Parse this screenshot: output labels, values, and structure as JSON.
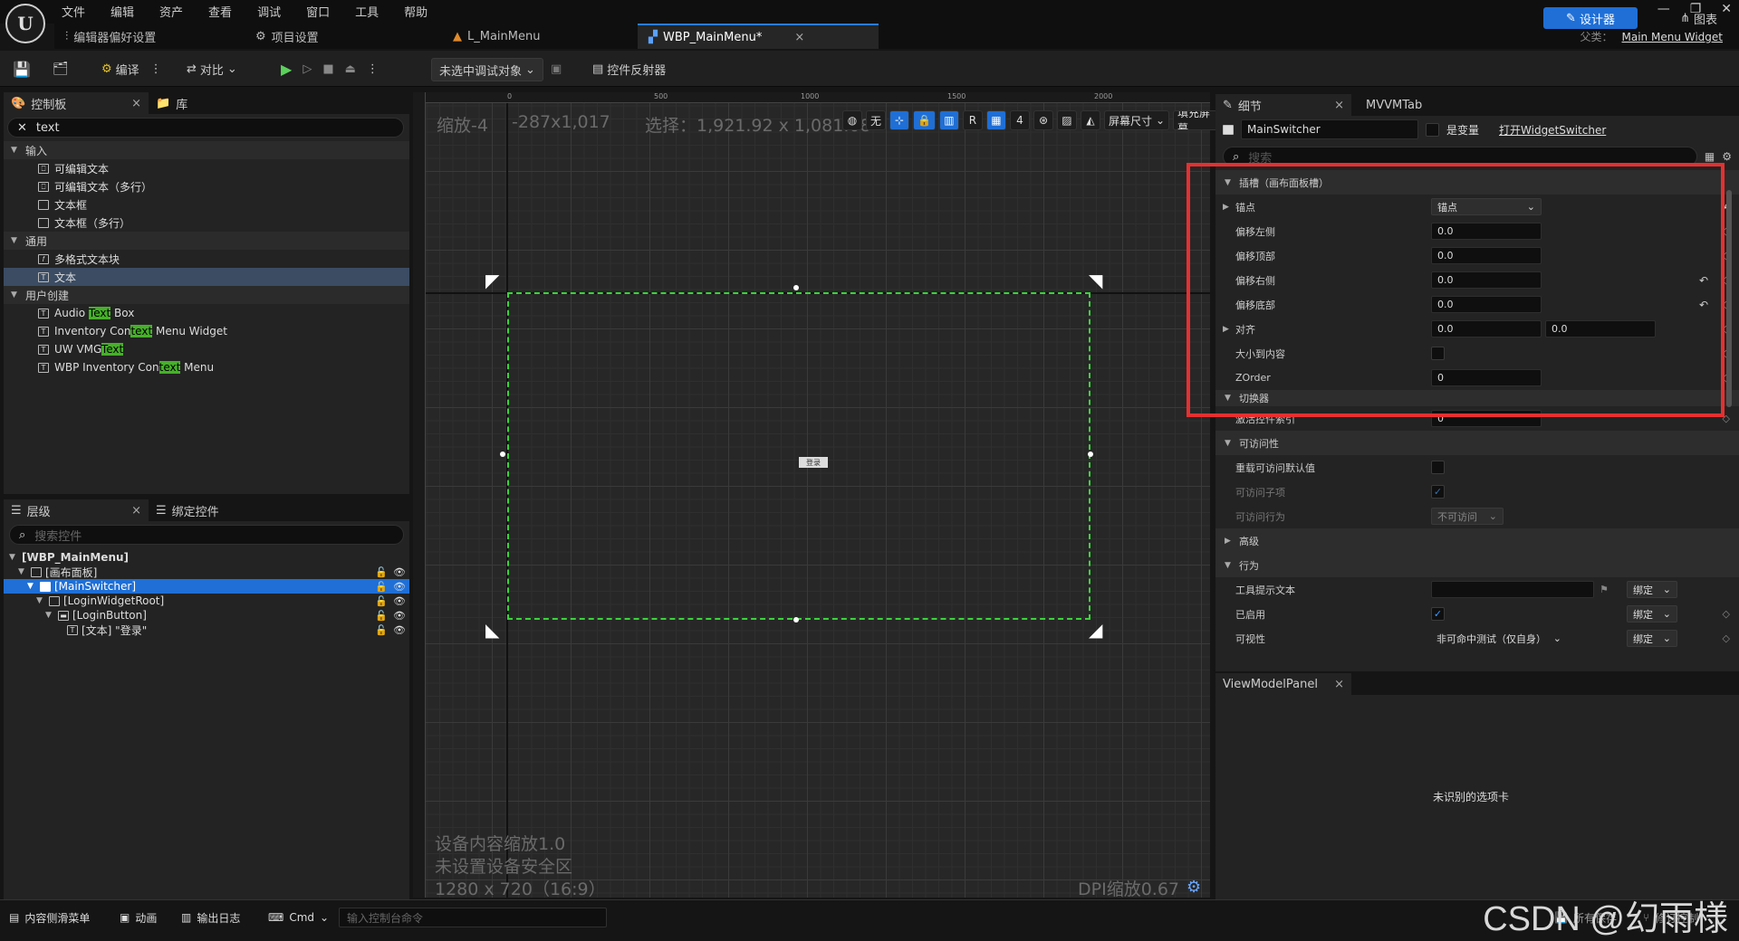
{
  "menu": [
    "文件",
    "编辑",
    "资产",
    "查看",
    "调试",
    "窗口",
    "工具",
    "帮助"
  ],
  "window_controls": {
    "minimize": "—",
    "restore": "❐",
    "close": "✕"
  },
  "tabs": {
    "editor_prefs": "编辑器偏好设置",
    "project_settings": "项目设置",
    "level": "L_MainMenu",
    "widget": "WBP_MainMenu*",
    "close": "×"
  },
  "parent_class": {
    "label": "父类：",
    "value": "Main Menu Widget"
  },
  "toolbar": {
    "compile": "编译",
    "diff": "对比",
    "debug_target": "未选中调试对象",
    "reflector": "控件反射器",
    "designer": "设计器",
    "graph": "图表"
  },
  "palette": {
    "tab": "控制板",
    "library_tab": "库",
    "close": "×",
    "search_value": "text",
    "categories": [
      {
        "name": "输入",
        "items": [
          "可编辑文本",
          "可编辑文本（多行）",
          "文本框",
          "文本框（多行）"
        ]
      },
      {
        "name": "通用",
        "items": [
          "多格式文本块",
          "文本"
        ]
      },
      {
        "name": "用户创建"
      }
    ],
    "user_items": [
      {
        "pre": "Audio ",
        "hl": "Text",
        "post": " Box"
      },
      {
        "pre": "Inventory Con",
        "hl": "text",
        "post": " Menu Widget"
      },
      {
        "pre": "UW VMG",
        "hl": "Text",
        "post": ""
      },
      {
        "pre": "WBP Inventory Con",
        "hl": "text",
        "post": " Menu"
      }
    ]
  },
  "hierarchy": {
    "tab": "层级",
    "bind_tab": "绑定控件",
    "close": "×",
    "search_placeholder": "搜索控件",
    "rows": [
      "[WBP_MainMenu]",
      "[画布面板]",
      "[MainSwitcher]",
      "[LoginWidgetRoot]",
      "[LoginButton]",
      "[文本] \"登录\""
    ]
  },
  "viewport": {
    "zoom": "缩放-4",
    "cursor": "-287x1,017",
    "selection": "选择：1,921.92 x 1,081.08",
    "none": "无",
    "r": "R",
    "grid_count": "4",
    "screen_size": "屏幕尺寸",
    "fill_screen": "填充屏幕",
    "ruler_ticks": [
      "0",
      "500",
      "1000",
      "1500",
      "2000"
    ],
    "device_scale": "设备内容缩放1.0",
    "no_safe_zone": "未设置设备安全区",
    "resolution": "1280 x 720（16:9）",
    "dpi": "DPI缩放0.67",
    "button_text": "登录"
  },
  "details": {
    "tab": "细节",
    "mvvm_tab": "MVVMTab",
    "close": "×",
    "widget_name": "MainSwitcher",
    "is_variable": "是变量",
    "open_widget_switcher": "打开WidgetSwitcher",
    "search_placeholder": "搜索",
    "slot_category": "插槽（画布面板槽）",
    "anchors_label": "锚点",
    "anchors_value": "锚点",
    "offset_left": {
      "label": "偏移左侧",
      "value": "0.0"
    },
    "offset_top": {
      "label": "偏移顶部",
      "value": "0.0"
    },
    "offset_right": {
      "label": "偏移右侧",
      "value": "0.0"
    },
    "offset_bottom": {
      "label": "偏移底部",
      "value": "0.0"
    },
    "alignment": {
      "label": "对齐",
      "x": "0.0",
      "y": "0.0"
    },
    "size_to_content": "大小到内容",
    "zorder": {
      "label": "ZOrder",
      "value": "0"
    },
    "switcher_category": "切换器",
    "active_index": {
      "label": "激活控件索引",
      "value": "0"
    },
    "accessibility_category": "可访问性",
    "override_accessible": "重载可访问默认值",
    "accessible_children": "可访问子项",
    "accessible_behavior": {
      "label": "可访问行为",
      "value": "不可访问"
    },
    "advanced_category": "高级",
    "behavior_category": "行为",
    "tooltip": {
      "label": "工具提示文本",
      "bind": "绑定"
    },
    "enabled": {
      "label": "已启用",
      "bind": "绑定"
    },
    "visibility": {
      "label": "可视性",
      "value": "非可命中测试（仅自身）",
      "bind": "绑定"
    }
  },
  "viewmodel": {
    "tab": "ViewModelPanel",
    "close": "×",
    "message": "未识别的选项卡"
  },
  "bottombar": {
    "content_drawer": "内容侧滑菜单",
    "animation": "动画",
    "output_log": "输出日志",
    "cmd": "Cmd",
    "console_placeholder": "输入控制台命令",
    "save_all": "所有保存",
    "revision": "修订控制"
  },
  "watermark": "CSDN @幻雨様",
  "colors": {
    "accent": "#1f6fd6",
    "selection_green": "#3bd43b",
    "highlight": "#e53030",
    "search_hl": "#46b02a"
  }
}
